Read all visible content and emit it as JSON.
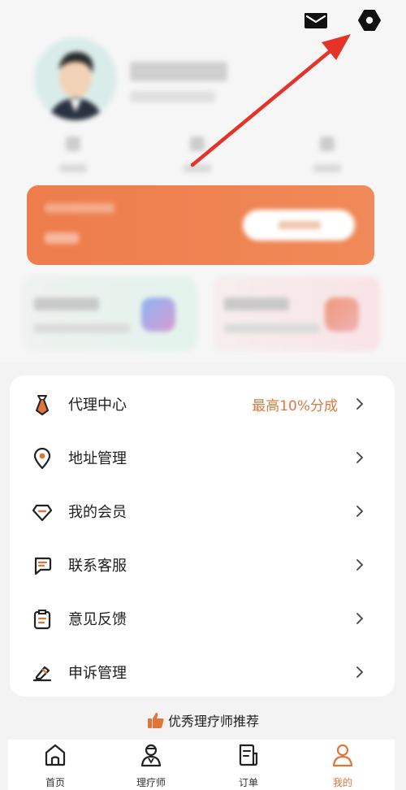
{
  "header": {
    "message_icon": "envelope-icon",
    "settings_icon": "hexagon-settings-icon"
  },
  "menu": {
    "items": [
      {
        "label": "代理中心",
        "extra": "最高10%分成",
        "icon": "tie-icon"
      },
      {
        "label": "地址管理",
        "extra": "",
        "icon": "location-pin-icon"
      },
      {
        "label": "我的会员",
        "extra": "",
        "icon": "diamond-icon"
      },
      {
        "label": "联系客服",
        "extra": "",
        "icon": "chat-bubble-icon"
      },
      {
        "label": "意见反馈",
        "extra": "",
        "icon": "clipboard-icon"
      },
      {
        "label": "申诉管理",
        "extra": "",
        "icon": "edit-icon"
      }
    ]
  },
  "recommend": {
    "label": "优秀理疗师推荐",
    "icon": "thumbs-up-icon"
  },
  "tabbar": {
    "tabs": [
      {
        "label": "首页",
        "icon": "home-icon"
      },
      {
        "label": "理疗师",
        "icon": "therapist-icon"
      },
      {
        "label": "订单",
        "icon": "order-icon"
      },
      {
        "label": "我的",
        "icon": "profile-icon",
        "active": true
      }
    ]
  },
  "colors": {
    "accent": "#e0753a",
    "banner": "#ee7c4c",
    "arrow": "#e5332a"
  }
}
